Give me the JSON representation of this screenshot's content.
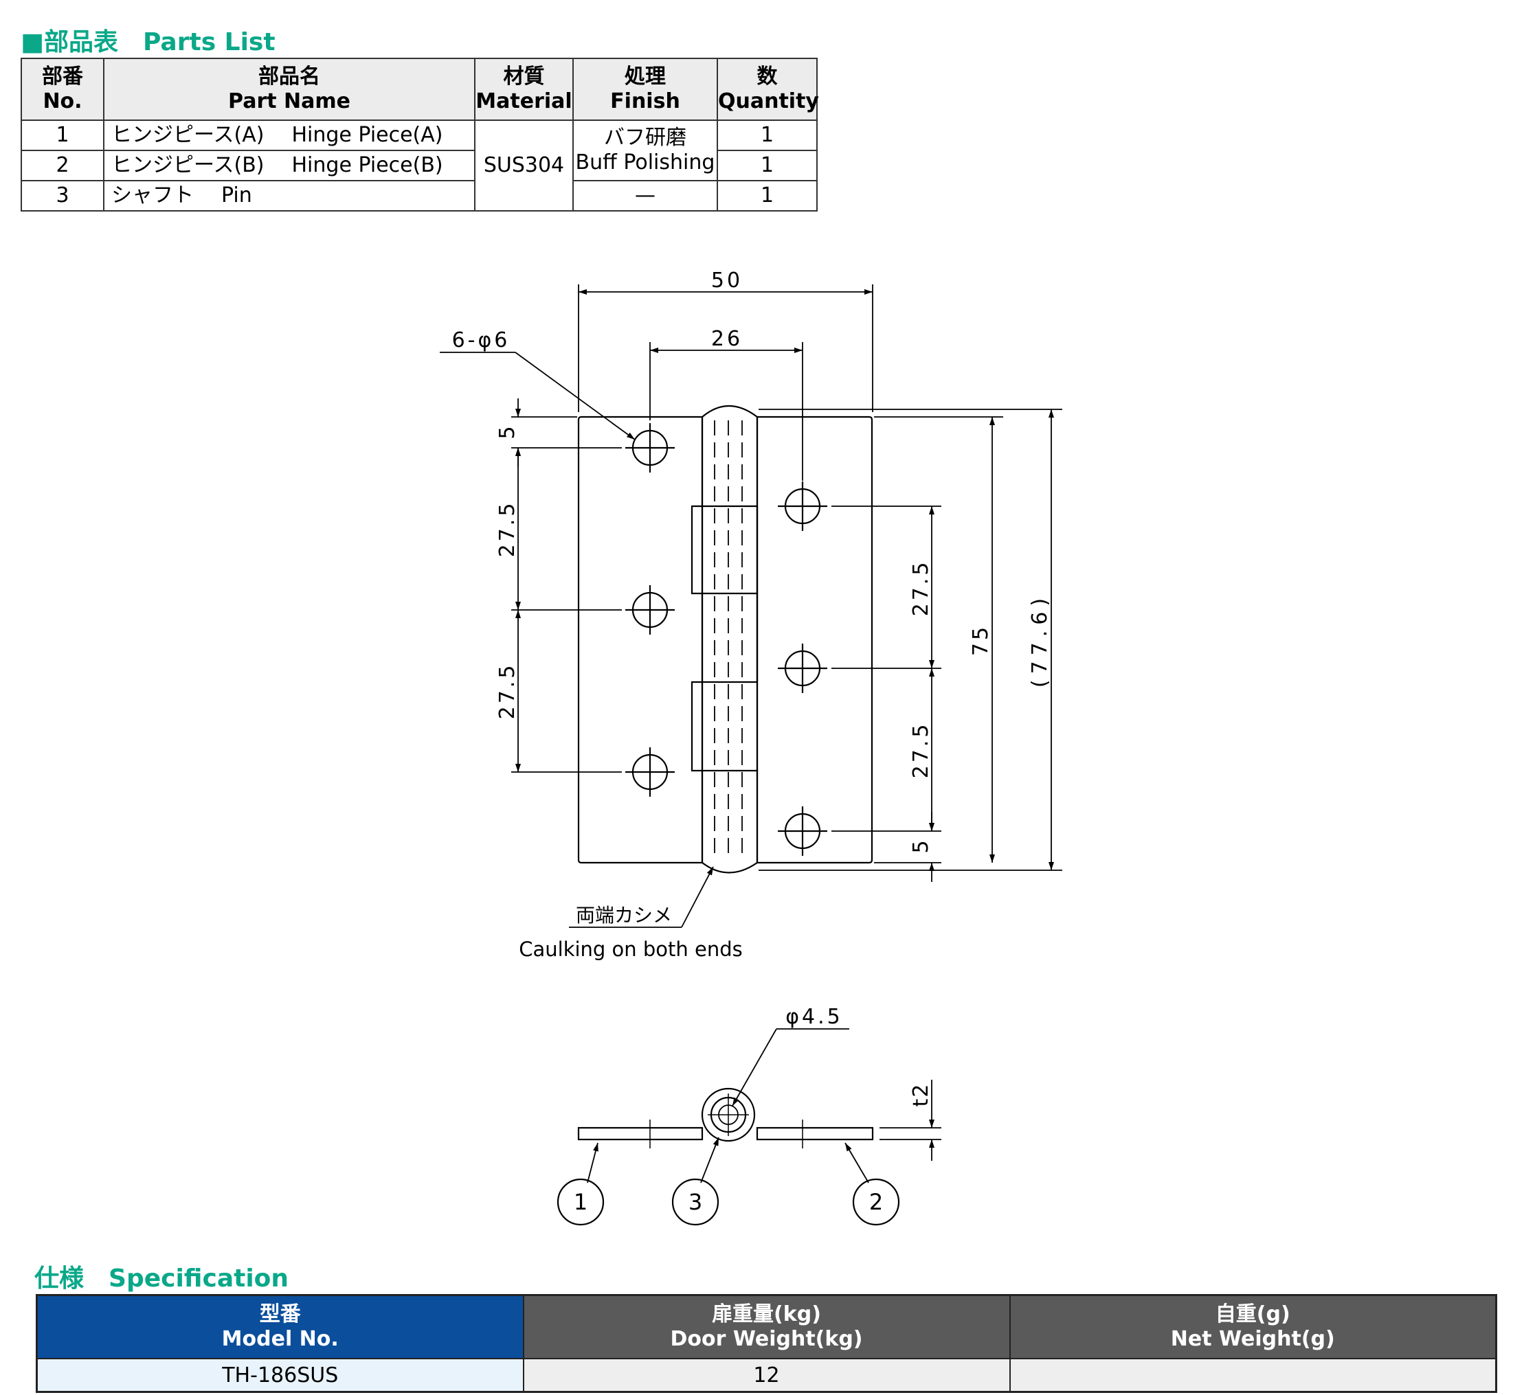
{
  "parts_section": {
    "title_ja": "■部品表",
    "title_en": "Parts List"
  },
  "parts_table": {
    "headers": [
      {
        "ja": "部番",
        "en": "No."
      },
      {
        "ja": "部品名",
        "en": "Part Name"
      },
      {
        "ja": "材質",
        "en": "Material"
      },
      {
        "ja": "処理",
        "en": "Finish"
      },
      {
        "ja": "数",
        "en": "Quantity"
      }
    ],
    "rows": [
      {
        "no": "1",
        "name_ja": "ヒンジピース(A)",
        "name_en": "Hinge Piece(A)",
        "quantity": "1"
      },
      {
        "no": "2",
        "name_ja": "ヒンジピース(B)",
        "name_en": "Hinge Piece(B)",
        "quantity": "1"
      },
      {
        "no": "3",
        "name_ja": "シャフト",
        "name_en": "Pin",
        "quantity": "1"
      }
    ],
    "material": "SUS304",
    "finish_ja": "バフ研磨",
    "finish_en": "Buff Polishing",
    "finish_pin": "—"
  },
  "drawing": {
    "dim_width": "50",
    "dim_hole_pitch_h": "26",
    "dim_holes": "6-φ6",
    "dim_top_offset": "5",
    "dim_pitch_left_1": "27.5",
    "dim_pitch_left_2": "27.5",
    "dim_pitch_right_1": "27.5",
    "dim_pitch_right_2": "27.5",
    "dim_bottom_offset": "5",
    "dim_height": "75",
    "dim_overall_height": "(77.6)",
    "caulking_ja": "両端カシメ",
    "caulking_en": "Caulking on both ends",
    "dim_pin": "φ4.5",
    "dim_thickness": "t2",
    "balloons": [
      "1",
      "3",
      "2"
    ]
  },
  "spec_section": {
    "title_ja": "仕様",
    "title_en": "Specification"
  },
  "spec_table": {
    "headers": [
      {
        "ja": "型番",
        "en": "Model No."
      },
      {
        "ja": "扉重量(kg)",
        "en": "Door Weight(kg)"
      },
      {
        "ja": "自重(g)",
        "en": "Net Weight(g)"
      }
    ],
    "row": {
      "model": "TH-186SUS",
      "door_weight": "12",
      "net_weight": ""
    }
  },
  "colors": {
    "accent": "#0aa889",
    "model_header": "#0b4e9c",
    "grey_header": "#5a5a5a"
  }
}
